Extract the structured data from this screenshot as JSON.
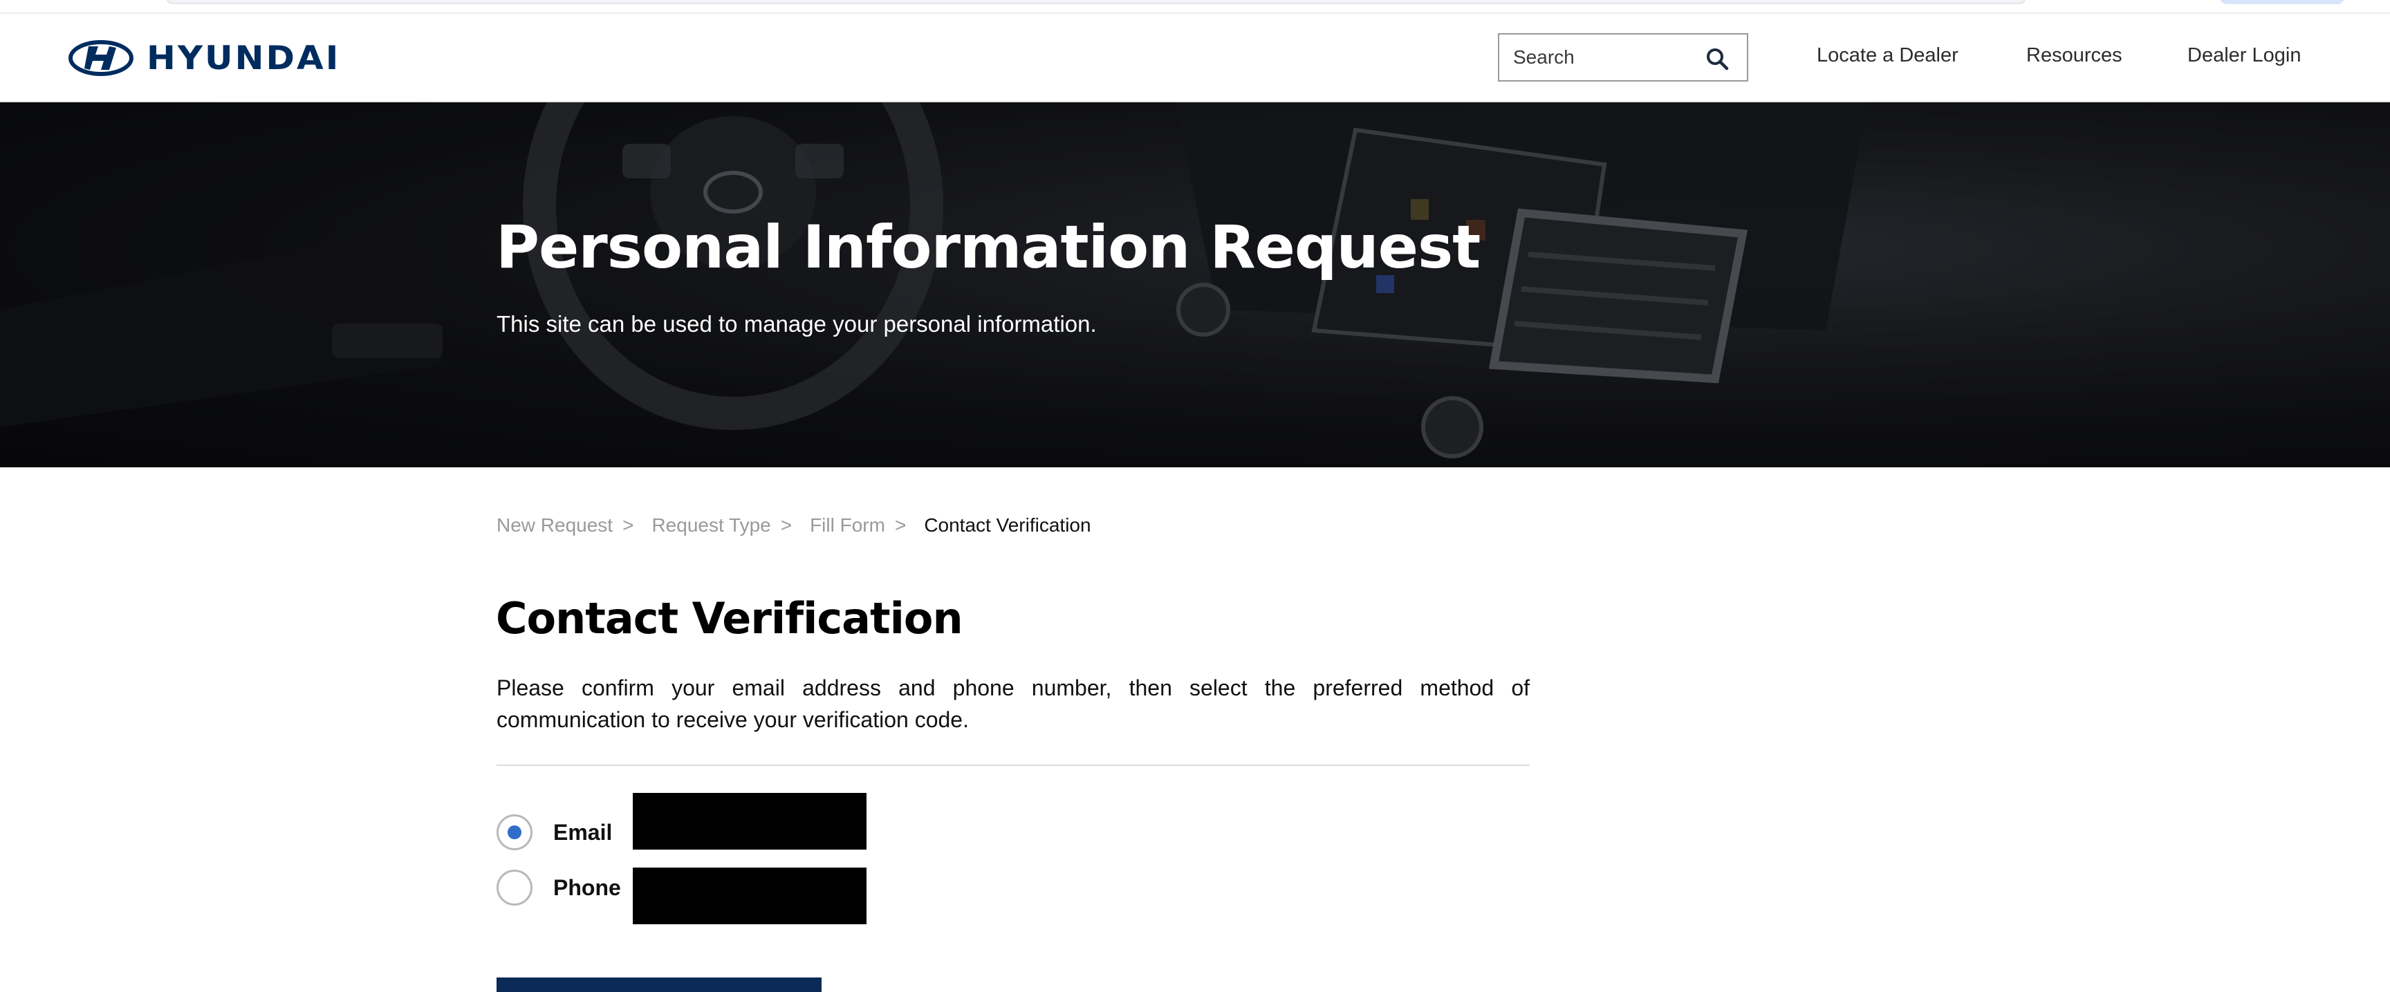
{
  "brand": {
    "name": "HYUNDAI",
    "color": "#002c5f"
  },
  "header": {
    "search": {
      "placeholder": "Search",
      "icon": "search-icon"
    },
    "nav": [
      {
        "label": "Locate a Dealer"
      },
      {
        "label": "Resources"
      },
      {
        "label": "Dealer Login"
      }
    ]
  },
  "hero": {
    "title": "Personal Information Request",
    "subtitle": "This site can be used to manage your personal information."
  },
  "breadcrumb": {
    "items": [
      {
        "label": "New Request",
        "sep": ">"
      },
      {
        "label": "Request Type",
        "sep": ">"
      },
      {
        "label": "Fill Form",
        "sep": ">"
      }
    ],
    "current": "Contact Verification"
  },
  "main": {
    "title": "Contact Verification",
    "instructions": "Please confirm your email address and phone number, then select the preferred method of communication to receive your verification code.",
    "options": [
      {
        "label": "Email",
        "selected": true
      },
      {
        "label": "Phone",
        "selected": false
      }
    ],
    "accent_color": "#2f6dc8",
    "button_color": "#0b2a56"
  }
}
